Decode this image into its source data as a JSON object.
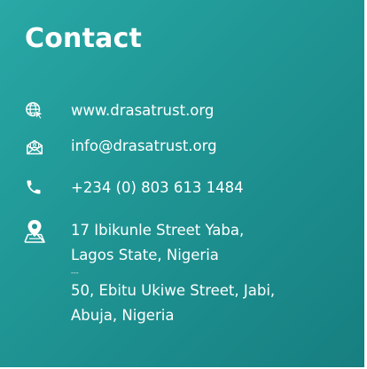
{
  "contact": {
    "title": "Contact",
    "website": {
      "icon": "globe-cursor-icon",
      "text": "www.drasatrust.org"
    },
    "email": {
      "icon": "mail-icon",
      "text": "info@drasatrust.org"
    },
    "phone": {
      "icon": "phone-icon",
      "text": "+234 (0) 803 613 1484"
    },
    "address": {
      "icon": "map-pin-icon",
      "line1": "17 Ibikunle Street Yaba,",
      "line2": "Lagos State, Nigeria",
      "separator": "---",
      "line3": "50, Ebitu Ukiwe Street, Jabi,",
      "line4": "Abuja, Nigeria"
    }
  },
  "colors": {
    "background_start": "#28a8a6",
    "background_end": "#177f80",
    "text": "#ffffff"
  }
}
